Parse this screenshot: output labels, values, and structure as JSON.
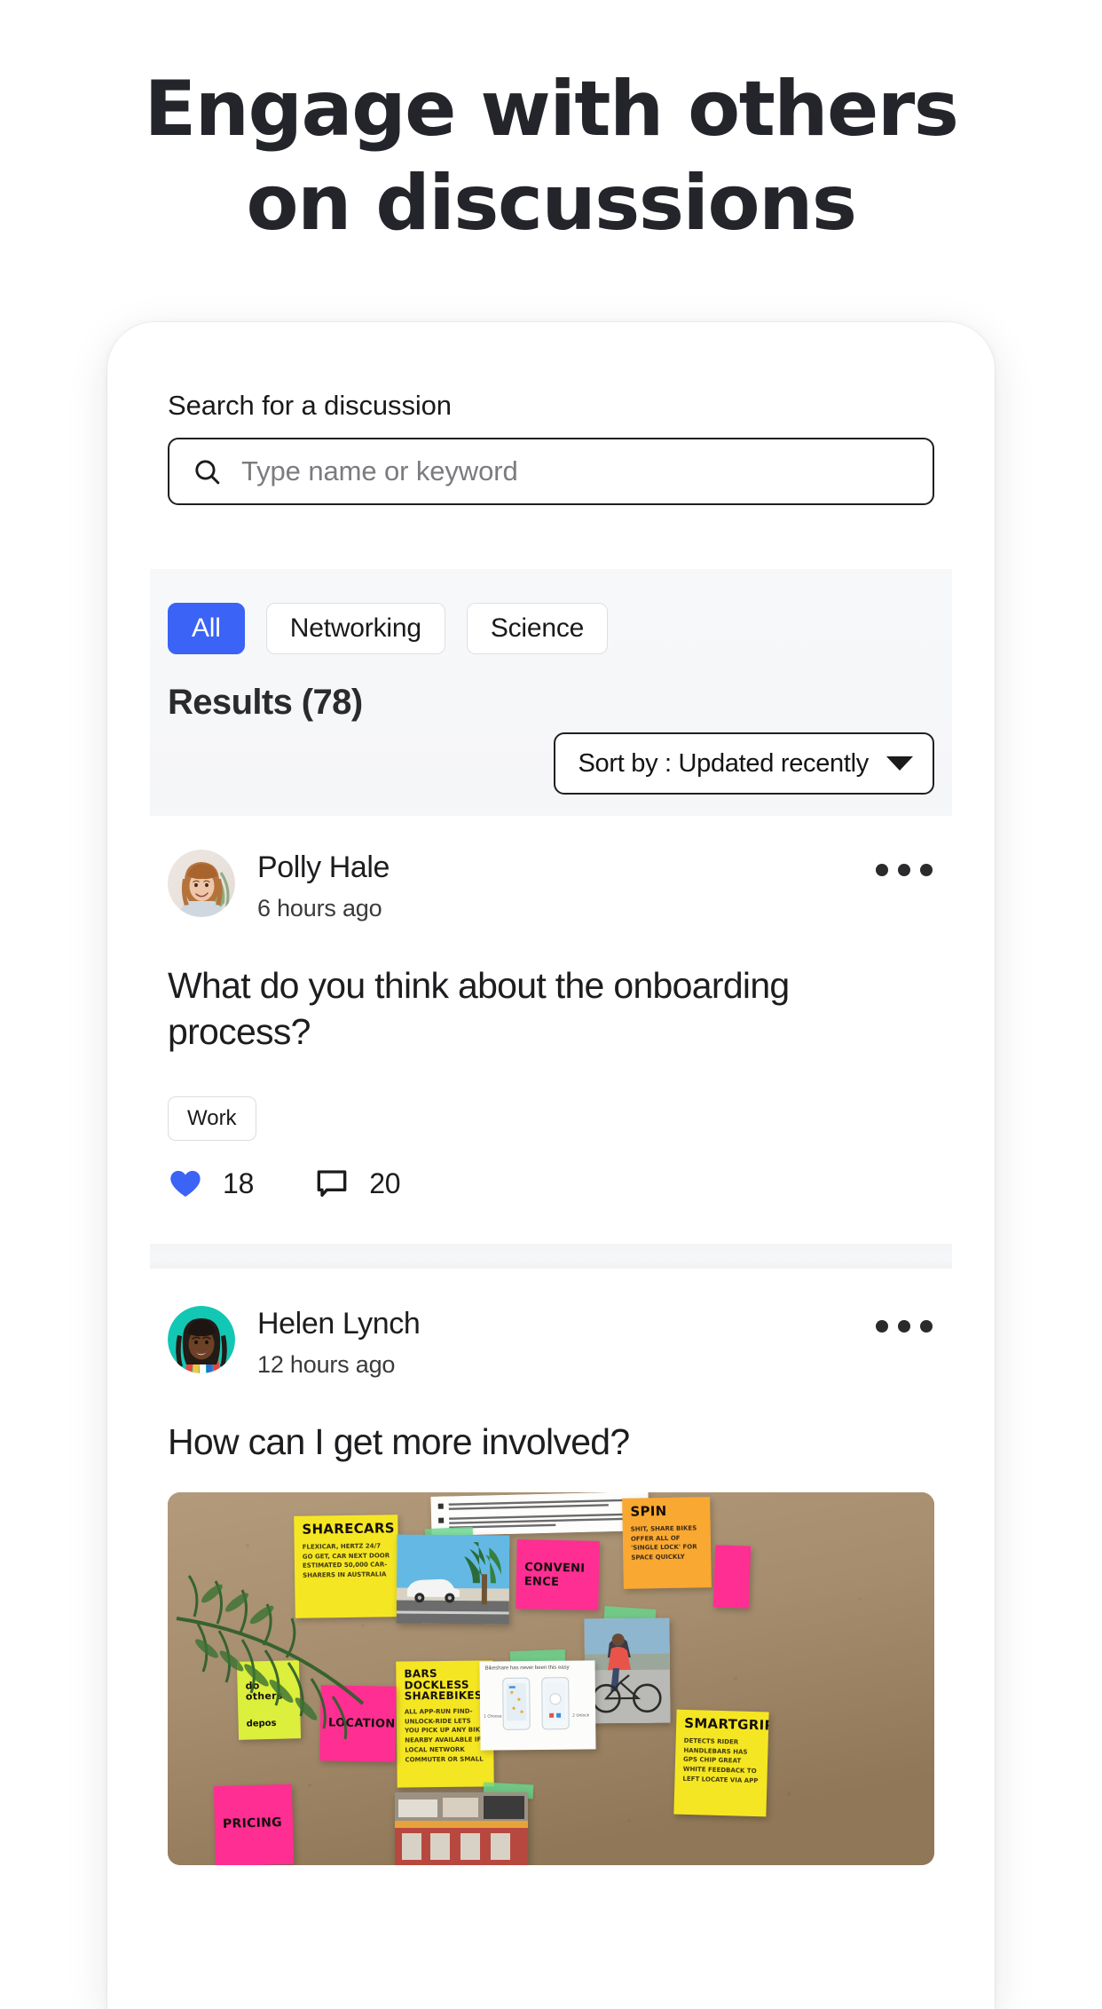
{
  "headline": {
    "line1": "Engage with others",
    "line2": "on discussions"
  },
  "search": {
    "label": "Search for a discussion",
    "placeholder": "Type name or keyword",
    "value": "",
    "icon": "search-icon"
  },
  "filters": {
    "chips": [
      {
        "label": "All",
        "active": true
      },
      {
        "label": "Networking",
        "active": false
      },
      {
        "label": "Science",
        "active": false
      }
    ],
    "results_label": "Results (78)",
    "results_count": 78,
    "sort": {
      "label": "Sort by : Updated recently",
      "selected": "Updated recently",
      "caret_icon": "chevron-down-icon"
    }
  },
  "posts": [
    {
      "author": "Polly Hale",
      "time": "6 hours ago",
      "title": "What do you think about the onboarding process?",
      "tag": "Work",
      "likes": "18",
      "comments": "20",
      "menu_icon": "more-horizontal-icon",
      "like_icon": "heart-icon",
      "comment_icon": "comment-icon",
      "avatar_name": "avatar-polly-hale"
    },
    {
      "author": "Helen Lynch",
      "time": "12 hours ago",
      "title": "How can I get more involved?",
      "menu_icon": "more-horizontal-icon",
      "avatar_name": "avatar-helen-lynch",
      "image_alt": "brainstorming wall with sticky notes"
    }
  ],
  "post_image_notes": [
    {
      "title": "SHARECARS",
      "body": "FLEXICAR, HERTZ 24/7 GO GET, CAR NEXT DOOR  ESTIMATED 50,000 CAR-SHARERS IN AUSTRALIA"
    },
    {
      "title": "SPIN",
      "body": "SHIT, SHARE BIKES OFFER ALL OF 'SINGLE LOCK' FOR SPACE QUICKLY"
    },
    {
      "title": "CONVENI ENCE",
      "body": ""
    },
    {
      "title": "LOCATION",
      "body": ""
    },
    {
      "title": "PRICING",
      "body": ""
    },
    {
      "title": "BARS DOCKLESS SHAREBIKES",
      "body": "ALL APP-RUN  FIND-UNLOCK-RIDE LETS YOU PICK UP ANY BIKE NEARBY  AVAILABLE IF LOCAL NETWORK COMMUTER OR SMALL"
    },
    {
      "title": "SMARTGRIPS",
      "body": "DETECTS RIDER HANDLEBARS HAS GPS CHIP GREAT WHITE FEEDBACK TO LEFT LOCATE VIA APP"
    },
    {
      "title": "do others",
      "body": "depos"
    }
  ],
  "post_image_paper": {
    "caption": "Bikeshare has never been this easy",
    "step_labels": [
      "1 Choose",
      "2 Unlock"
    ]
  },
  "colors": {
    "accent": "#3b63f5",
    "text": "#1d1d20",
    "panel_bg": "#f6f7f9",
    "placeholder": "#7b7b80"
  }
}
